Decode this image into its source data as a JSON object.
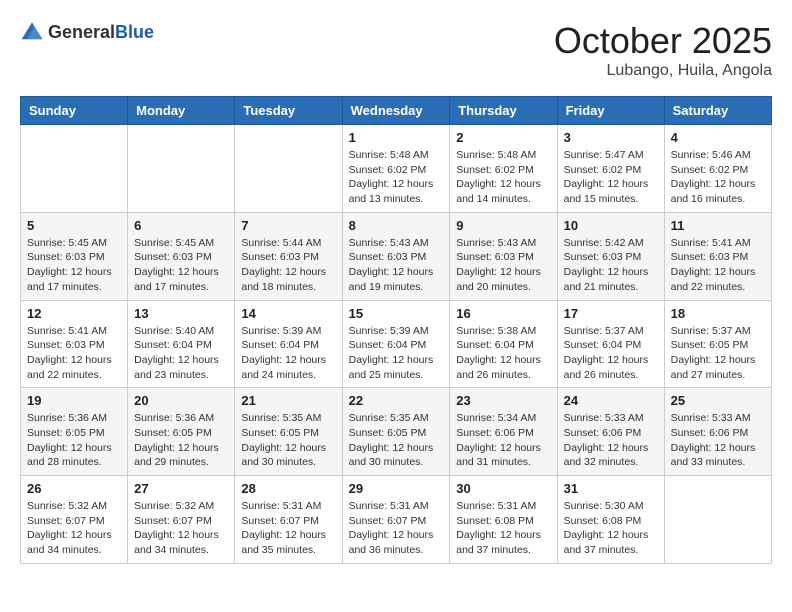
{
  "header": {
    "logo_general": "General",
    "logo_blue": "Blue",
    "month": "October 2025",
    "location": "Lubango, Huila, Angola"
  },
  "weekdays": [
    "Sunday",
    "Monday",
    "Tuesday",
    "Wednesday",
    "Thursday",
    "Friday",
    "Saturday"
  ],
  "weeks": [
    [
      {
        "day": "",
        "sunrise": "",
        "sunset": "",
        "daylight": ""
      },
      {
        "day": "",
        "sunrise": "",
        "sunset": "",
        "daylight": ""
      },
      {
        "day": "",
        "sunrise": "",
        "sunset": "",
        "daylight": ""
      },
      {
        "day": "1",
        "sunrise": "Sunrise: 5:48 AM",
        "sunset": "Sunset: 6:02 PM",
        "daylight": "Daylight: 12 hours and 13 minutes."
      },
      {
        "day": "2",
        "sunrise": "Sunrise: 5:48 AM",
        "sunset": "Sunset: 6:02 PM",
        "daylight": "Daylight: 12 hours and 14 minutes."
      },
      {
        "day": "3",
        "sunrise": "Sunrise: 5:47 AM",
        "sunset": "Sunset: 6:02 PM",
        "daylight": "Daylight: 12 hours and 15 minutes."
      },
      {
        "day": "4",
        "sunrise": "Sunrise: 5:46 AM",
        "sunset": "Sunset: 6:02 PM",
        "daylight": "Daylight: 12 hours and 16 minutes."
      }
    ],
    [
      {
        "day": "5",
        "sunrise": "Sunrise: 5:45 AM",
        "sunset": "Sunset: 6:03 PM",
        "daylight": "Daylight: 12 hours and 17 minutes."
      },
      {
        "day": "6",
        "sunrise": "Sunrise: 5:45 AM",
        "sunset": "Sunset: 6:03 PM",
        "daylight": "Daylight: 12 hours and 17 minutes."
      },
      {
        "day": "7",
        "sunrise": "Sunrise: 5:44 AM",
        "sunset": "Sunset: 6:03 PM",
        "daylight": "Daylight: 12 hours and 18 minutes."
      },
      {
        "day": "8",
        "sunrise": "Sunrise: 5:43 AM",
        "sunset": "Sunset: 6:03 PM",
        "daylight": "Daylight: 12 hours and 19 minutes."
      },
      {
        "day": "9",
        "sunrise": "Sunrise: 5:43 AM",
        "sunset": "Sunset: 6:03 PM",
        "daylight": "Daylight: 12 hours and 20 minutes."
      },
      {
        "day": "10",
        "sunrise": "Sunrise: 5:42 AM",
        "sunset": "Sunset: 6:03 PM",
        "daylight": "Daylight: 12 hours and 21 minutes."
      },
      {
        "day": "11",
        "sunrise": "Sunrise: 5:41 AM",
        "sunset": "Sunset: 6:03 PM",
        "daylight": "Daylight: 12 hours and 22 minutes."
      }
    ],
    [
      {
        "day": "12",
        "sunrise": "Sunrise: 5:41 AM",
        "sunset": "Sunset: 6:03 PM",
        "daylight": "Daylight: 12 hours and 22 minutes."
      },
      {
        "day": "13",
        "sunrise": "Sunrise: 5:40 AM",
        "sunset": "Sunset: 6:04 PM",
        "daylight": "Daylight: 12 hours and 23 minutes."
      },
      {
        "day": "14",
        "sunrise": "Sunrise: 5:39 AM",
        "sunset": "Sunset: 6:04 PM",
        "daylight": "Daylight: 12 hours and 24 minutes."
      },
      {
        "day": "15",
        "sunrise": "Sunrise: 5:39 AM",
        "sunset": "Sunset: 6:04 PM",
        "daylight": "Daylight: 12 hours and 25 minutes."
      },
      {
        "day": "16",
        "sunrise": "Sunrise: 5:38 AM",
        "sunset": "Sunset: 6:04 PM",
        "daylight": "Daylight: 12 hours and 26 minutes."
      },
      {
        "day": "17",
        "sunrise": "Sunrise: 5:37 AM",
        "sunset": "Sunset: 6:04 PM",
        "daylight": "Daylight: 12 hours and 26 minutes."
      },
      {
        "day": "18",
        "sunrise": "Sunrise: 5:37 AM",
        "sunset": "Sunset: 6:05 PM",
        "daylight": "Daylight: 12 hours and 27 minutes."
      }
    ],
    [
      {
        "day": "19",
        "sunrise": "Sunrise: 5:36 AM",
        "sunset": "Sunset: 6:05 PM",
        "daylight": "Daylight: 12 hours and 28 minutes."
      },
      {
        "day": "20",
        "sunrise": "Sunrise: 5:36 AM",
        "sunset": "Sunset: 6:05 PM",
        "daylight": "Daylight: 12 hours and 29 minutes."
      },
      {
        "day": "21",
        "sunrise": "Sunrise: 5:35 AM",
        "sunset": "Sunset: 6:05 PM",
        "daylight": "Daylight: 12 hours and 30 minutes."
      },
      {
        "day": "22",
        "sunrise": "Sunrise: 5:35 AM",
        "sunset": "Sunset: 6:05 PM",
        "daylight": "Daylight: 12 hours and 30 minutes."
      },
      {
        "day": "23",
        "sunrise": "Sunrise: 5:34 AM",
        "sunset": "Sunset: 6:06 PM",
        "daylight": "Daylight: 12 hours and 31 minutes."
      },
      {
        "day": "24",
        "sunrise": "Sunrise: 5:33 AM",
        "sunset": "Sunset: 6:06 PM",
        "daylight": "Daylight: 12 hours and 32 minutes."
      },
      {
        "day": "25",
        "sunrise": "Sunrise: 5:33 AM",
        "sunset": "Sunset: 6:06 PM",
        "daylight": "Daylight: 12 hours and 33 minutes."
      }
    ],
    [
      {
        "day": "26",
        "sunrise": "Sunrise: 5:32 AM",
        "sunset": "Sunset: 6:07 PM",
        "daylight": "Daylight: 12 hours and 34 minutes."
      },
      {
        "day": "27",
        "sunrise": "Sunrise: 5:32 AM",
        "sunset": "Sunset: 6:07 PM",
        "daylight": "Daylight: 12 hours and 34 minutes."
      },
      {
        "day": "28",
        "sunrise": "Sunrise: 5:31 AM",
        "sunset": "Sunset: 6:07 PM",
        "daylight": "Daylight: 12 hours and 35 minutes."
      },
      {
        "day": "29",
        "sunrise": "Sunrise: 5:31 AM",
        "sunset": "Sunset: 6:07 PM",
        "daylight": "Daylight: 12 hours and 36 minutes."
      },
      {
        "day": "30",
        "sunrise": "Sunrise: 5:31 AM",
        "sunset": "Sunset: 6:08 PM",
        "daylight": "Daylight: 12 hours and 37 minutes."
      },
      {
        "day": "31",
        "sunrise": "Sunrise: 5:30 AM",
        "sunset": "Sunset: 6:08 PM",
        "daylight": "Daylight: 12 hours and 37 minutes."
      },
      {
        "day": "",
        "sunrise": "",
        "sunset": "",
        "daylight": ""
      }
    ]
  ]
}
